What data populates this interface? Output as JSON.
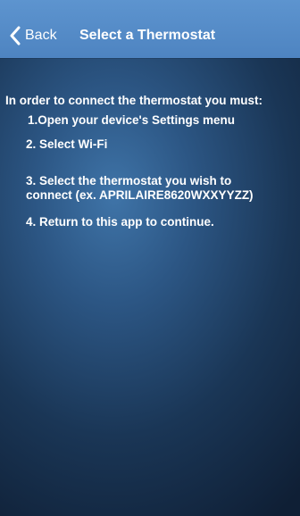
{
  "navbar": {
    "back_label": "Back",
    "title": "Select a Thermostat"
  },
  "instructions": {
    "intro": "In order to connect the thermostat you must:",
    "steps": [
      "1.Open your device's Settings menu",
      "2. Select Wi-Fi",
      "3. Select the thermostat you wish to",
      "connect (ex. APRILAIRE8620WXXYYZZ)",
      "4. Return to this app to continue."
    ]
  },
  "colors": {
    "navbar": "#5289c6",
    "background_center": "#3f74a8",
    "background_edge": "#0f1f35",
    "text": "#ffffff"
  },
  "icons": {
    "back": "chevron-left-icon"
  }
}
